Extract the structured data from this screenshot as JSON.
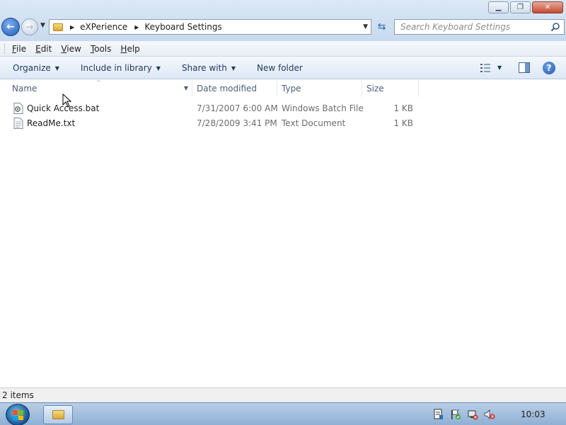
{
  "window": {
    "caption_buttons": [
      "minimize",
      "maximize",
      "close"
    ]
  },
  "address": {
    "crumbs": [
      "eXPerience",
      "Keyboard Settings"
    ]
  },
  "search": {
    "placeholder": "Search Keyboard Settings"
  },
  "menu": [
    "File",
    "Edit",
    "View",
    "Tools",
    "Help"
  ],
  "commands": {
    "organize": "Organize",
    "include_in_library": "Include in library",
    "share_with": "Share with",
    "new_folder": "New folder"
  },
  "columns": {
    "name": "Name",
    "date_modified": "Date modified",
    "type": "Type",
    "size": "Size"
  },
  "files": [
    {
      "name": "Quick Access.bat",
      "date": "7/31/2007 6:00 AM",
      "type": "Windows Batch File",
      "size": "1 KB",
      "icon": "batch-file-icon"
    },
    {
      "name": "ReadMe.txt",
      "date": "7/28/2009 3:41 PM",
      "type": "Text Document",
      "size": "1 KB",
      "icon": "text-file-icon"
    }
  ],
  "status": {
    "item_count": "2 items"
  },
  "taskbar": {
    "clock": "10:03"
  },
  "colors": {
    "titlebar": "#c8daef",
    "commandbar": "#dde8f5",
    "link_text": "#1e395b",
    "close_button": "#c44a32"
  }
}
